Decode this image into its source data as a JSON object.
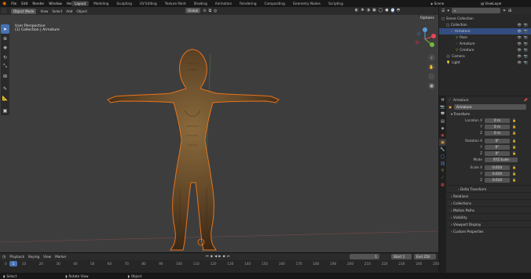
{
  "topbar": {
    "menus": [
      "File",
      "Edit",
      "Render",
      "Window",
      "Help"
    ],
    "tabs": [
      "Layout",
      "Modeling",
      "Sculpting",
      "UV Editing",
      "Texture Paint",
      "Shading",
      "Animation",
      "Rendering",
      "Compositing",
      "Geometry Nodes",
      "Scripting"
    ],
    "scene": "Scene",
    "view_layer": "ViewLayer"
  },
  "viewport": {
    "mode": "Object Mode",
    "menus": [
      "View",
      "Select",
      "Add",
      "Object"
    ],
    "transform_orientation": "Global",
    "perspective_label": "User Perspective",
    "collection_label": "(1) Collection | Armature",
    "options_label": "Options"
  },
  "timeline": {
    "menus": [
      "Playback",
      "Keying",
      "View",
      "Marker"
    ],
    "current_frame": "1",
    "start_label": "Start",
    "start_value": "1",
    "end_label": "End",
    "end_value": "250",
    "ticks": [
      "0",
      "10",
      "20",
      "30",
      "40",
      "50",
      "60",
      "70",
      "80",
      "90",
      "100",
      "110",
      "120",
      "130",
      "140",
      "150",
      "160",
      "170",
      "180",
      "190",
      "200",
      "210",
      "220",
      "230",
      "240",
      "250"
    ]
  },
  "statusbar": {
    "items": [
      "Select",
      "Rotate View",
      "Object"
    ]
  },
  "outliner": {
    "search_placeholder": "",
    "rows": [
      {
        "label": "Scene Collection",
        "indent": 0,
        "selected": false
      },
      {
        "label": "Collection",
        "indent": 1,
        "selected": false
      },
      {
        "label": "Armature",
        "indent": 2,
        "selected": true
      },
      {
        "label": "Pose",
        "indent": 3,
        "selected": false
      },
      {
        "label": "Armature",
        "indent": 3,
        "selected": false
      },
      {
        "label": "Creature",
        "indent": 3,
        "selected": false
      },
      {
        "label": "Camera",
        "indent": 1,
        "selected": false
      },
      {
        "label": "Light",
        "indent": 1,
        "selected": false
      }
    ]
  },
  "properties": {
    "object_name": "Armature",
    "object_field": "Armature",
    "transform_label": "Transform",
    "location_label": "Location X",
    "location": [
      "0 m",
      "0 m",
      "0 m"
    ],
    "rotation_label": "Rotation X",
    "rotation": [
      "0°",
      "0°",
      "0°"
    ],
    "mode_label": "Mode",
    "mode_value": "XYZ Euler",
    "scale_label": "Scale X",
    "scale": [
      "0.010",
      "0.010",
      "0.010"
    ],
    "axis_y": "Y",
    "axis_z": "Z",
    "panels": [
      "Delta Transform",
      "Relations",
      "Collections",
      "Motion Paths",
      "Visibility",
      "Viewport Display",
      "Custom Properties"
    ]
  },
  "colors": {
    "accent": "#4772b3",
    "selection_outline": "#e8741c",
    "viewport_bg": "#3d3d3d"
  }
}
